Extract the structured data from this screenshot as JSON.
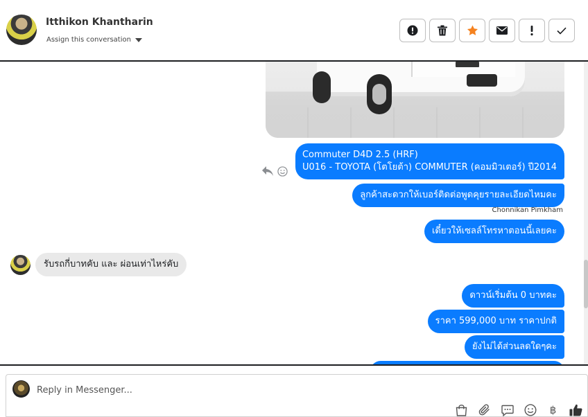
{
  "header": {
    "contact_name": "Itthikon Khantharin",
    "assign_label": "Assign this conversation",
    "actions": [
      {
        "icon": "alert-circle-icon",
        "label": ""
      },
      {
        "icon": "trash-icon",
        "label": ""
      },
      {
        "icon": "star-icon",
        "label": "",
        "color": "#f5821f"
      },
      {
        "icon": "envelope-icon",
        "label": ""
      },
      {
        "icon": "exclamation-icon",
        "label": "!"
      },
      {
        "icon": "checkmark-icon",
        "label": ""
      }
    ]
  },
  "messages": {
    "outgoing_1_line1": "Commuter D4D 2.5 (HRF)",
    "outgoing_1_line2": "U016 - TOYOTA (โตโยต้า) COMMUTER (คอมมิวเตอร์) ปี2014",
    "outgoing_2": "ลูกค้าสะดวกให้เบอร์ติดต่อพูดคุยรายละเอียดไหมคะ",
    "sender_label": "Chonnikan Pimkham",
    "outgoing_3": "เดี๋ยวให้เซลล์โทรหาตอนนี้เลยคะ",
    "incoming_1": "รับรถกี่บาทคับ และ ผ่อนเท่าไหร่คับ",
    "outgoing_4": "ดาวน์เริ่มต้น 0 บาทคะ",
    "outgoing_5": "ราคา 599,000 บาท ราคาปกติ",
    "outgoing_6": "ยังไม่ได้ส่วนลดใดๆคะ"
  },
  "composer": {
    "placeholder": "Reply in Messenger...",
    "tools": [
      "shopping-bag-icon",
      "paperclip-icon",
      "saved-replies-icon",
      "emoji-icon",
      "baht-icon",
      "thumbs-up-icon"
    ],
    "baht_symbol": "฿"
  },
  "colors": {
    "outgoing_bubble": "#0a7cff",
    "incoming_bubble": "#e9e9e9",
    "star": "#f5821f"
  }
}
